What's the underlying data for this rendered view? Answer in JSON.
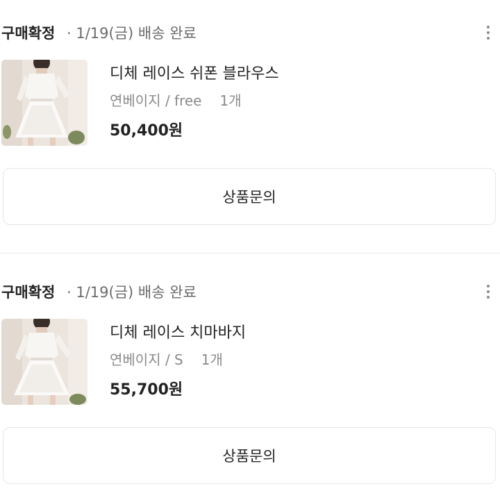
{
  "orders": [
    {
      "status": "구매확정",
      "status_detail": "· 1/19(금) 배송 완료",
      "more_icon": "more-vertical-icon",
      "product": {
        "name": "디체 레이스 쉬폰 블라우스",
        "option": "연베이지 / free",
        "quantity": "1개",
        "price": "50,400원"
      },
      "inquiry_label": "상품문의"
    },
    {
      "status": "구매확정",
      "status_detail": "· 1/19(금) 배송 완료",
      "more_icon": "more-vertical-icon",
      "product": {
        "name": "디체 레이스 치마바지",
        "option": "연베이지 / S",
        "quantity": "1개",
        "price": "55,700원"
      },
      "inquiry_label": "상품문의"
    }
  ],
  "colors": {
    "text": "#222222",
    "secondary": "#8a8a8a",
    "border": "#e6e6e6",
    "divider": "#ececec"
  }
}
